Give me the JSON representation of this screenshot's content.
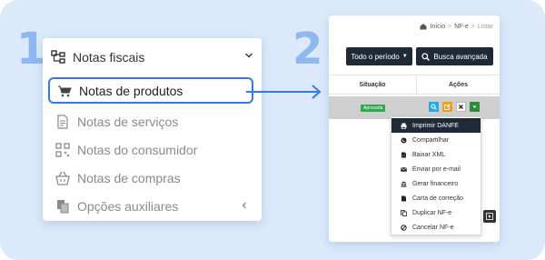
{
  "steps": {
    "one": "1",
    "two": "2"
  },
  "colors": {
    "accent": "#2f7de1",
    "step": "#8fb8ef",
    "dark": "#1f2a36",
    "background": "#dce9fb",
    "badge": "#2fa84f"
  },
  "sidebar": {
    "title": "Notas fiscais",
    "title_icon": "sitemap-icon",
    "items": [
      {
        "label": "Notas de produtos",
        "icon": "cart-icon",
        "active": true
      },
      {
        "label": "Notas de serviços",
        "icon": "document-icon",
        "active": false
      },
      {
        "label": "Notas do consumidor",
        "icon": "qrcode-icon",
        "active": false
      },
      {
        "label": "Notas de compras",
        "icon": "basket-icon",
        "active": false
      },
      {
        "label": "Opções auxiliares",
        "icon": "copy-icon",
        "active": false
      }
    ]
  },
  "app": {
    "breadcrumb": [
      "Início",
      "NF-e",
      "Listar"
    ],
    "period_button": "Todo o período",
    "search_button": "Busca avançada",
    "columns": [
      "Situação",
      "Ações"
    ],
    "row": {
      "status": "Aprovada"
    },
    "menu_items": [
      {
        "label": "Imprimir DANFE",
        "icon": "print-icon"
      },
      {
        "label": "Compartilhar",
        "icon": "whatsapp-icon"
      },
      {
        "label": "Baixar XML",
        "icon": "code-file-icon"
      },
      {
        "label": "Enviar por e-mail",
        "icon": "envelope-icon"
      },
      {
        "label": "Gerar financeiro",
        "icon": "bank-icon"
      },
      {
        "label": "Carta de correção",
        "icon": "file-icon"
      },
      {
        "label": "Duplicar NF-e",
        "icon": "duplicate-icon"
      },
      {
        "label": "Cancelar NF-e",
        "icon": "ban-icon"
      }
    ]
  }
}
